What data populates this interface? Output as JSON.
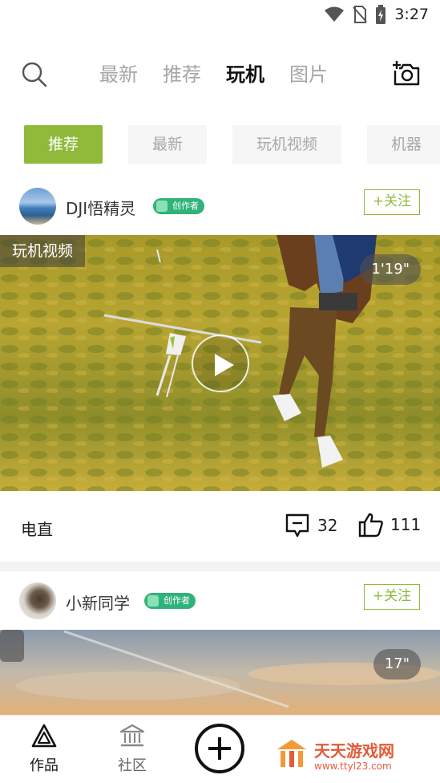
{
  "status_bar": {
    "time": "3:27"
  },
  "top_nav": {
    "tabs": [
      "最新",
      "推荐",
      "玩机",
      "图片"
    ],
    "active": "玩机"
  },
  "sub_tabs": {
    "items": [
      "推荐",
      "最新",
      "玩机视频",
      "机器"
    ],
    "active": "推荐"
  },
  "posts": [
    {
      "username": "DJI悟精灵",
      "badge": "创作者",
      "follow_label": "+关注",
      "video_tag": "玩机视频",
      "duration": "1'19\"",
      "title": "电直",
      "comments": "32",
      "likes": "111"
    },
    {
      "username": "小新同学",
      "badge": "创作者",
      "follow_label": "+关注",
      "duration": "17\""
    }
  ],
  "bottom_nav": {
    "works_label": "作品",
    "community_label": "社区"
  },
  "watermark": {
    "title": "天天游戏网",
    "url": "www.ttyl23.com"
  },
  "colors": {
    "accent": "#8fba3a",
    "badge": "#30b37a",
    "watermark": "#e35b3a"
  }
}
